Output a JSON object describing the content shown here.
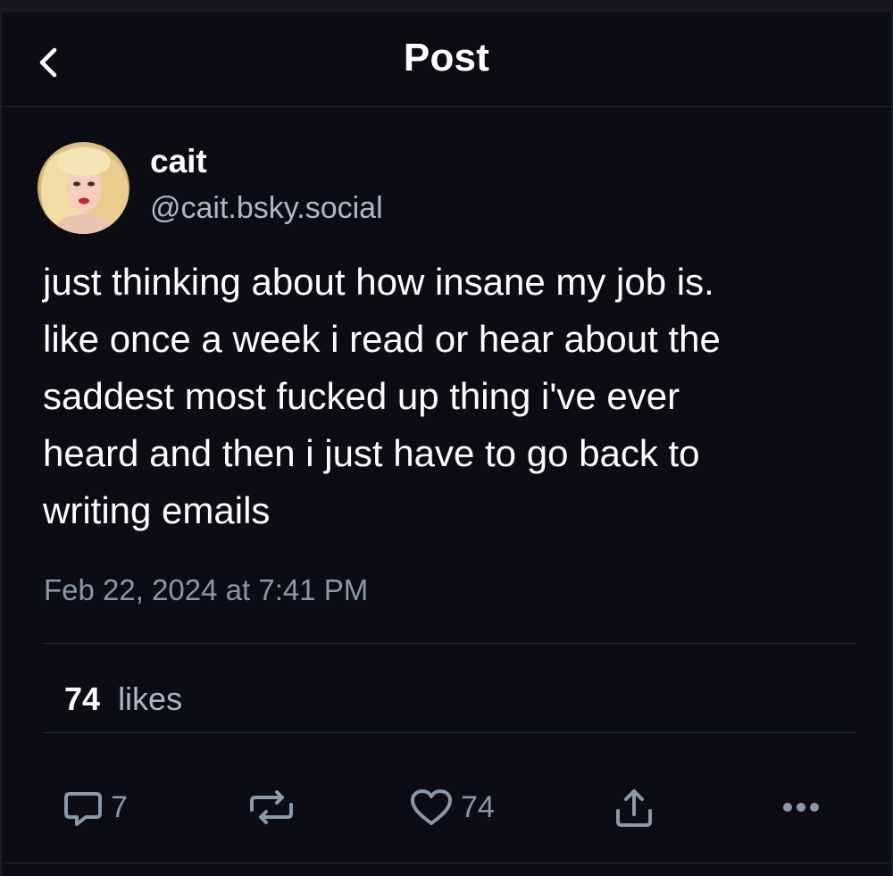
{
  "header": {
    "title": "Post",
    "back_icon": "chevron-left-icon"
  },
  "author": {
    "display_name": "cait",
    "handle": "@cait.bsky.social"
  },
  "post": {
    "lines": [
      "just thinking about how insane my job is.",
      "like once a week i read or hear about the",
      "saddest most fucked up thing i've ever",
      "heard and then i just have to go back to",
      "writing emails"
    ],
    "timestamp": "Feb 22, 2024 at 7:41 PM"
  },
  "stats": {
    "likes_count": "74",
    "likes_label": "likes"
  },
  "actions": {
    "reply_count": "7",
    "like_count": "74",
    "icons": [
      "reply-icon",
      "repost-icon",
      "heart-icon",
      "share-icon",
      "more-icon"
    ]
  },
  "colors": {
    "background": "#0b0d12",
    "secondary_text": "#8b98a8",
    "handle_text": "#aeb8c4",
    "divider": "#283039"
  }
}
